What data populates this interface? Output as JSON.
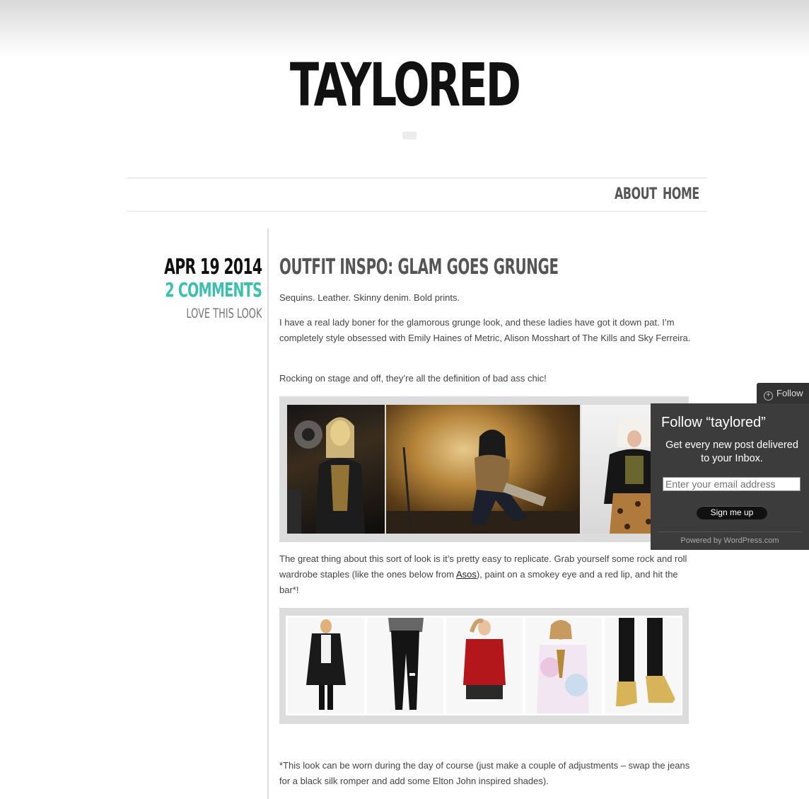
{
  "site": {
    "title": "TAYLORED"
  },
  "nav": {
    "items": [
      "ABOUT",
      "HOME"
    ]
  },
  "post": {
    "date": "APR 19 2014",
    "comments": "2 COMMENTS",
    "tag": "LOVE THIS LOOK",
    "title": "OUTFIT INSPO: GLAM GOES GRUNGE",
    "p1": "Sequins. Leather. Skinny denim. Bold prints.",
    "p2": "I have a real lady boner for the glamorous grunge look, and these ladies have got it down pat. I’m completely style obsessed with Emily Haines of Metric, Alison Mosshart of The Kills and Sky Ferreira.",
    "p3": "Rocking on stage and off, they’re all the definition of bad ass chic!",
    "p4_before": "The great thing about this sort of look is it’s pretty easy to replicate. Grab yourself some rock and roll wardrobe staples (like the ones below from ",
    "p4_link": "Asos",
    "p4_after": "), paint on a smokey eye and a red lip, and hit the bar*!",
    "p5": "*This look can be worn during the day of course (just make a couple of adjustments – swap the jeans for a black silk romper and add some Elton John inspired shades)."
  },
  "follow": {
    "button_label": "Follow",
    "panel_title": "Follow “taylored”",
    "description": "Get every new post delivered to your Inbox.",
    "email_placeholder": "Enter your email address",
    "signup_label": "Sign me up",
    "powered": "Powered by WordPress.com"
  },
  "colors": {
    "accent": "#3cbfad",
    "panel": "#3c3c3c"
  }
}
